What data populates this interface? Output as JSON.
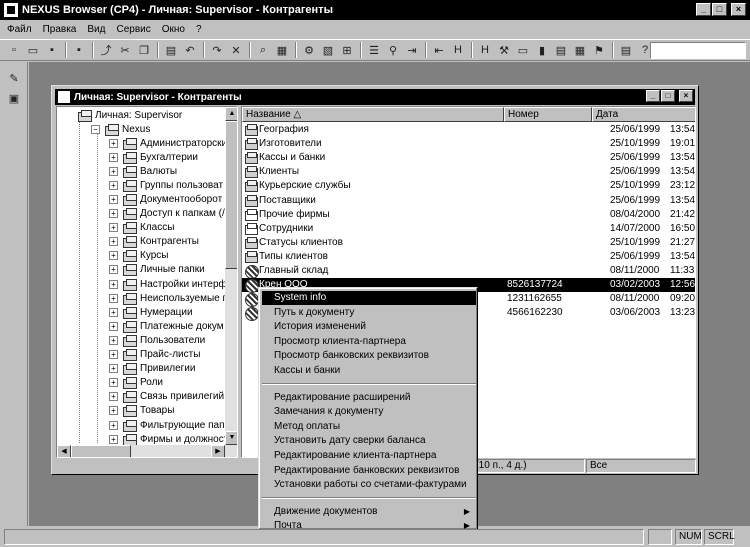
{
  "app": {
    "title": "NEXUS Browser (CP4) - Личная: Supervisor - Контрагенты",
    "controls": {
      "min": "_",
      "max": "□",
      "close": "×"
    }
  },
  "menu": [
    "Файл",
    "Правка",
    "Вид",
    "Сервис",
    "Окно",
    "?"
  ],
  "toolbar_icons": [
    "new-icon",
    "open-icon",
    "save-icon",
    "save-all-icon",
    "up-folder-icon",
    "cut-icon",
    "copy-icon",
    "paste-icon",
    "undo-icon",
    "redo-icon",
    "delete-icon",
    "find-icon",
    "print-icon",
    "properties-icon",
    "view-icon",
    "tree-icon",
    "list-icon",
    "binoculars-icon",
    "export-icon",
    "import-icon",
    "h1-icon",
    "h2-icon",
    "wrench-icon",
    "window-icon",
    "chart-icon",
    "tile-icon",
    "grid-icon",
    "flag-icon",
    "table-icon",
    "help-icon",
    "context-help-icon"
  ],
  "window": {
    "title": "Личная: Supervisor - Контрагенты",
    "controls": {
      "min": "_",
      "max": "□",
      "close": "×"
    }
  },
  "tree": {
    "root": "Личная: Supervisor",
    "child": "Nexus",
    "items": [
      "Администраторски",
      "Бухгалтерии",
      "Валюты",
      "Группы пользоват",
      "Документооборот",
      "Доступ к папкам (/",
      "Классы",
      "Контрагенты",
      "Курсы",
      "Личные папки",
      "Настройки интерф",
      "Неиспользуемые п",
      "Нумерации",
      "Платежные докум",
      "Пользователи",
      "Прайс-листы",
      "Привилегии",
      "Роли",
      "Связь привилегий",
      "Товары",
      "Фильтрующие пап",
      "Фирмы и должност"
    ]
  },
  "list": {
    "headers": {
      "name": "Название",
      "number": "Номер",
      "date": "Дата"
    },
    "rows": [
      {
        "icon": "folder",
        "name": "География",
        "number": "",
        "date": "25/06/1999",
        "time": "13:54"
      },
      {
        "icon": "folder",
        "name": "Изготовители",
        "number": "",
        "date": "25/10/1999",
        "time": "19:01"
      },
      {
        "icon": "folder",
        "name": "Кассы и банки",
        "number": "",
        "date": "25/06/1999",
        "time": "13:54"
      },
      {
        "icon": "folder",
        "name": "Клиенты",
        "number": "",
        "date": "25/06/1999",
        "time": "13:54"
      },
      {
        "icon": "folder",
        "name": "Курьерские службы",
        "number": "",
        "date": "25/10/1999",
        "time": "23:12"
      },
      {
        "icon": "folder",
        "name": "Поставщики",
        "number": "",
        "date": "25/06/1999",
        "time": "13:54"
      },
      {
        "icon": "plain",
        "name": "Прочие фирмы",
        "number": "",
        "date": "08/04/2000",
        "time": "21:42"
      },
      {
        "icon": "plain",
        "name": "Сотрудники",
        "number": "",
        "date": "14/07/2000",
        "time": "16:50"
      },
      {
        "icon": "folder",
        "name": "Статусы клиентов",
        "number": "",
        "date": "25/10/1999",
        "time": "21:27"
      },
      {
        "icon": "folder",
        "name": "Типы клиентов",
        "number": "",
        "date": "25/06/1999",
        "time": "13:54"
      },
      {
        "icon": "ent",
        "name": "Главный склад",
        "number": "",
        "date": "08/11/2000",
        "time": "11:33"
      },
      {
        "icon": "ent",
        "name": "Крен ООО",
        "number": "8526137724",
        "date": "03/02/2003",
        "time": "12:56",
        "selected": true
      },
      {
        "icon": "ent",
        "name": "",
        "number": "1231162655",
        "date": "08/11/2000",
        "time": "09:20"
      },
      {
        "icon": "ent",
        "name": "",
        "number": "4566162230",
        "date": "03/06/2003",
        "time": "13:23"
      }
    ],
    "status_count": "4 (10 п., 4 д.)",
    "status_filter": "Все"
  },
  "context_menu": {
    "group1": [
      "System info",
      "Путь к документу",
      "История изменений",
      "Просмотр клиента-партнера",
      "Просмотр банковских реквизитов",
      "Кассы и банки"
    ],
    "group2": [
      "Редактирование расширений",
      "Замечания к документу",
      "Метод оплаты",
      "Установить дату сверки баланса",
      "Редактирование клиента-партнера",
      "Редактирование банковских реквизитов",
      "Установки работы со счетами-фактурами"
    ],
    "group3": [
      "Движение документов",
      "Почта"
    ],
    "submenu_arrow": "▶"
  },
  "statusbar": {
    "num": "NUM",
    "scrl": "SCRL"
  }
}
